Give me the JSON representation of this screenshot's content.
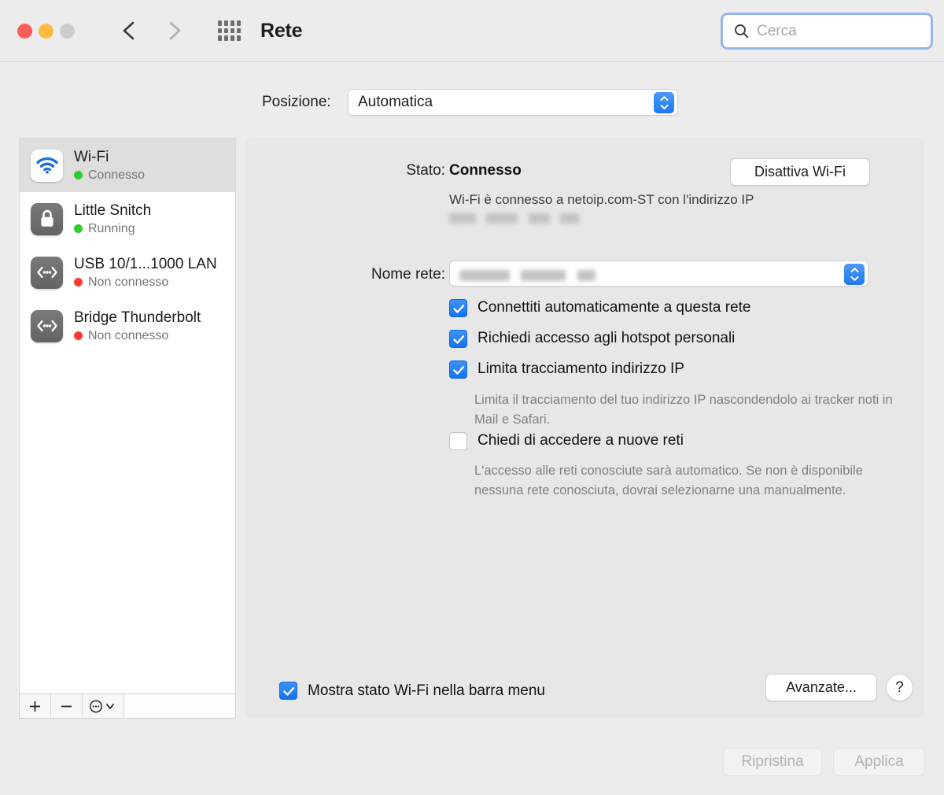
{
  "window": {
    "title": "Rete",
    "traffic_lights": [
      "close",
      "minimize",
      "zoom"
    ],
    "back_label": "Indietro",
    "forward_label": "Avanti",
    "grid_label": "Mostra tutto"
  },
  "search": {
    "placeholder": "Cerca",
    "value": ""
  },
  "location": {
    "label": "Posizione:",
    "value": "Automatica"
  },
  "sidebar": {
    "services": [
      {
        "name": "Wi-Fi",
        "status": "Connesso",
        "status_color": "green",
        "icon": "wifi-icon",
        "selected": true
      },
      {
        "name": "Little Snitch",
        "status": "Running",
        "status_color": "green",
        "icon": "lock-icon",
        "selected": false
      },
      {
        "name": "USB 10/1...1000 LAN",
        "status": "Non connesso",
        "status_color": "red",
        "icon": "ethernet-icon",
        "selected": false
      },
      {
        "name": "Bridge Thunderbolt",
        "status": "Non connesso",
        "status_color": "red",
        "icon": "ethernet-icon",
        "selected": false
      }
    ],
    "toolbar": {
      "add_label": "+",
      "remove_label": "−",
      "actions_label": "⊙"
    }
  },
  "main": {
    "stato_label": "Stato:",
    "stato_value": "Connesso",
    "disable_wifi_button": "Disattiva Wi-Fi",
    "stato_description": "Wi-Fi è connesso a netoip.com-ST con l'indirizzo IP",
    "ip_redacted": true,
    "network_label": "Nome rete:",
    "network_value_redacted": true,
    "checkboxes": [
      {
        "label": "Connettiti automaticamente a questa rete",
        "checked": true
      },
      {
        "label": "Richiedi accesso agli hotspot personali",
        "checked": true
      },
      {
        "label": "Limita tracciamento indirizzo IP",
        "checked": true
      },
      {
        "label": "Chiedi di accedere a nuove reti",
        "checked": false
      }
    ],
    "helper_limit_tracking": "Limita il tracciamento del tuo indirizzo IP nascondendolo ai tracker noti in Mail e Safari.",
    "helper_new_networks": "L'accesso alle reti conosciute sarà automatico. Se non è disponibile nessuna rete conosciuta, dovrai selezionarne una manualmente.",
    "show_status_checkbox": {
      "label": "Mostra stato Wi-Fi nella barra menu",
      "checked": true
    },
    "advanced_button": "Avanzate...",
    "help_button": "?"
  },
  "footer": {
    "restore_button": "Ripristina",
    "apply_button": "Applica",
    "restore_enabled": false,
    "apply_enabled": false
  },
  "colors": {
    "accent": "#1473ee",
    "green": "#2fcc2f",
    "red": "#fc3b30",
    "window_bg": "#ececec",
    "panel_bg": "#e7e7e7"
  }
}
